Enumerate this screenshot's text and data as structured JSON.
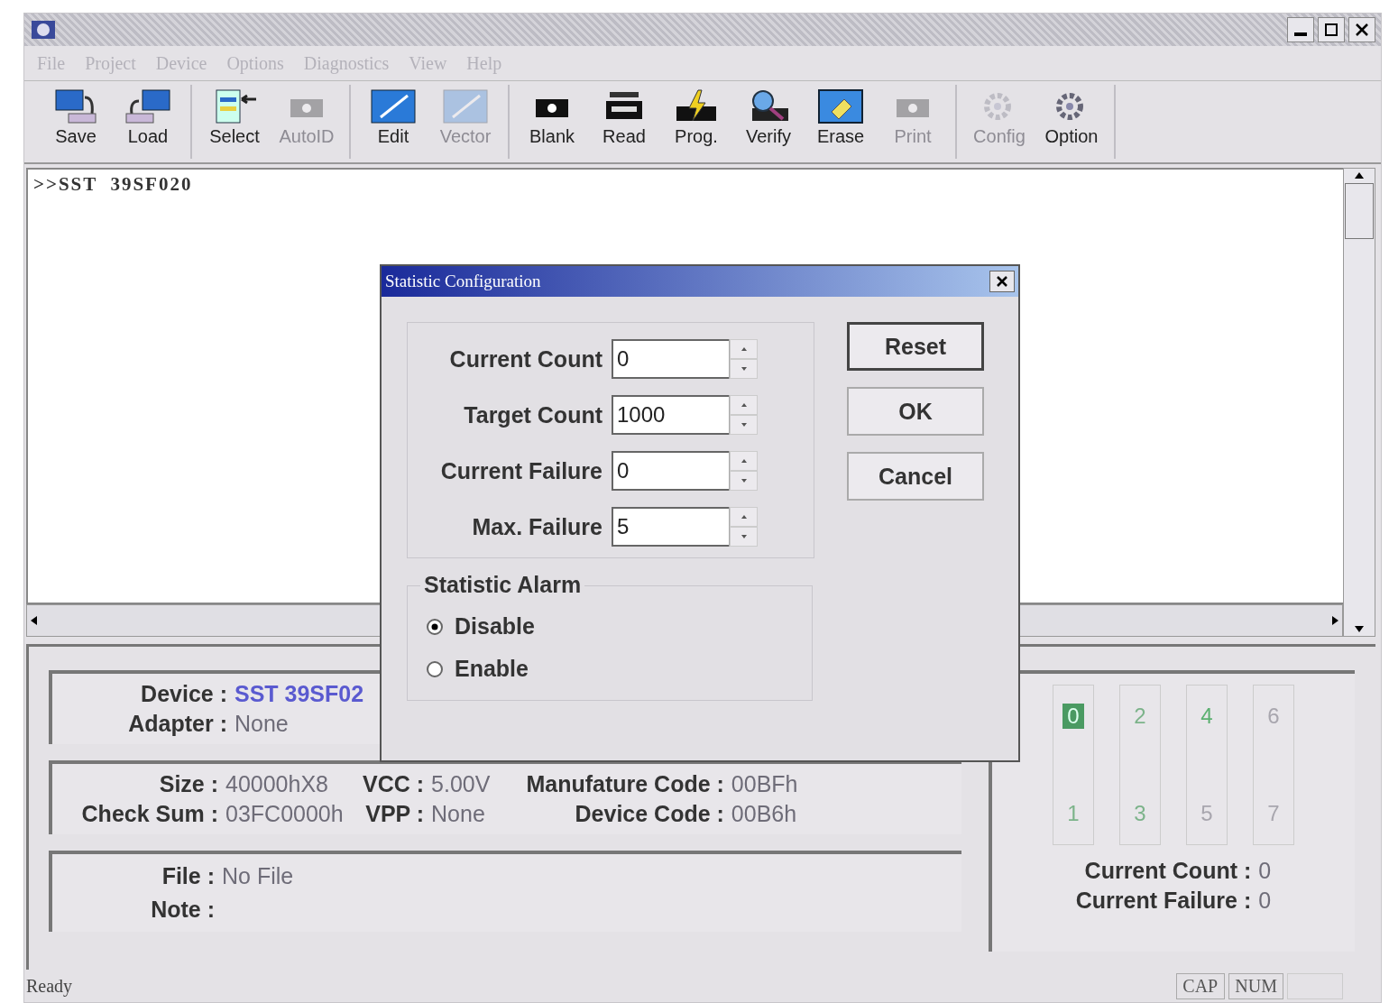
{
  "menu": [
    {
      "label": "File"
    },
    {
      "label": "Project"
    },
    {
      "label": "Device"
    },
    {
      "label": "Options"
    },
    {
      "label": "Diagnostics"
    },
    {
      "label": "View"
    },
    {
      "label": "Help"
    }
  ],
  "toolbar_groups": [
    {
      "buttons": [
        {
          "label": "Save",
          "kind": "save",
          "disabled": false
        },
        {
          "label": "Load",
          "kind": "load",
          "disabled": false
        }
      ]
    },
    {
      "buttons": [
        {
          "label": "Select",
          "kind": "select",
          "disabled": false
        },
        {
          "label": "AutoID",
          "kind": "chip",
          "disabled": true
        }
      ]
    },
    {
      "buttons": [
        {
          "label": "Edit",
          "kind": "edit",
          "disabled": false
        },
        {
          "label": "Vector",
          "kind": "edit",
          "disabled": true
        }
      ]
    },
    {
      "buttons": [
        {
          "label": "Blank",
          "kind": "chip",
          "disabled": false
        },
        {
          "label": "Read",
          "kind": "read",
          "disabled": false
        },
        {
          "label": "Prog.",
          "kind": "prog",
          "disabled": false
        },
        {
          "label": "Verify",
          "kind": "verify",
          "disabled": false
        },
        {
          "label": "Erase",
          "kind": "erase",
          "disabled": false
        },
        {
          "label": "Print",
          "kind": "chip",
          "disabled": true
        }
      ]
    },
    {
      "buttons": [
        {
          "label": "Config",
          "kind": "config",
          "disabled": true
        },
        {
          "label": "Option",
          "kind": "config",
          "disabled": false
        }
      ]
    }
  ],
  "log": {
    "lines": [
      ">>SST  39SF020"
    ]
  },
  "device_panel": {
    "rows": [
      {
        "label": "Device :",
        "value": "SST 39SF02",
        "emphasis": true
      },
      {
        "label": "Adapter :",
        "value": "None",
        "emphasis": false
      }
    ]
  },
  "spec_panel": {
    "columns": [
      {
        "rows": [
          {
            "label": "Size :",
            "value": "40000hX8"
          },
          {
            "label": "Check Sum :",
            "value": "03FC0000h"
          }
        ]
      },
      {
        "rows": [
          {
            "label": "VCC :",
            "value": "5.00V"
          },
          {
            "label": "VPP :",
            "value": "None"
          }
        ]
      },
      {
        "rows": [
          {
            "label": "Manufature Code :",
            "value": "00BFh"
          },
          {
            "label": "Device Code :",
            "value": "00B6h"
          }
        ]
      }
    ]
  },
  "file_panel": {
    "rows": [
      {
        "label": "File :",
        "value": "No File"
      },
      {
        "label": "Note :"
      }
    ]
  },
  "socket_panel": {
    "sockets": [
      {
        "number": "0",
        "kind": "active"
      },
      {
        "number": "1",
        "kind": "ready"
      },
      {
        "number": "2",
        "kind": "ready"
      },
      {
        "number": "3",
        "kind": "ready"
      },
      {
        "number": "4",
        "kind": "good"
      },
      {
        "number": "5",
        "kind": "idle"
      },
      {
        "number": "6",
        "kind": "idle"
      },
      {
        "number": "7",
        "kind": "idle"
      }
    ],
    "rows": [
      {
        "label": "Current Count :",
        "value": "0"
      },
      {
        "label": "Current Failure :",
        "value": "0"
      }
    ]
  },
  "status_bar": {
    "message": "Ready",
    "indicators": [
      "CAP",
      "NUM"
    ]
  },
  "dialog": {
    "title": "Statistic Configuration",
    "fields": [
      {
        "label": "Current Count",
        "value": "0"
      },
      {
        "label": "Target Count",
        "value": "1000"
      },
      {
        "label": "Current Failure",
        "value": "0"
      },
      {
        "label": "Max. Failure",
        "value": "5"
      }
    ],
    "buttons": [
      {
        "label": "Reset",
        "default": true
      },
      {
        "label": "OK",
        "default": false
      },
      {
        "label": "Cancel",
        "default": false
      }
    ],
    "alarm": {
      "title": "Statistic Alarm",
      "options": [
        {
          "label": "Disable",
          "selected": true
        },
        {
          "label": "Enable",
          "selected": false
        }
      ]
    }
  }
}
